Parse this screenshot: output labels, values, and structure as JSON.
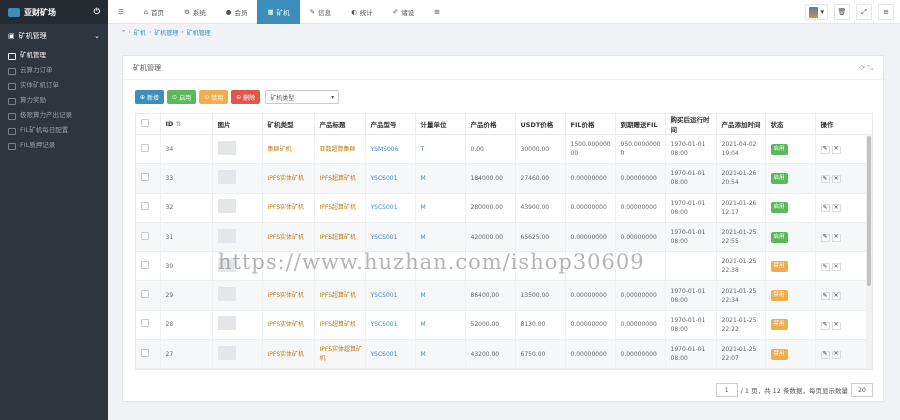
{
  "app": {
    "logo_text": "亚财矿场"
  },
  "sidebar": {
    "section": "矿机管理",
    "items": [
      {
        "label": "矿机管理"
      },
      {
        "label": "云算力订单"
      },
      {
        "label": "实体矿机订单"
      },
      {
        "label": "算力奖励"
      },
      {
        "label": "极限算力产出记录"
      },
      {
        "label": "FIL矿机每日配置"
      },
      {
        "label": "FIL质押记录"
      }
    ]
  },
  "topnav": {
    "items": [
      {
        "label": "首页",
        "icon": "home"
      },
      {
        "label": "系统",
        "icon": "gear"
      },
      {
        "label": "会员",
        "icon": "user"
      },
      {
        "label": "矿机",
        "icon": "grid"
      },
      {
        "label": "信息",
        "icon": "wrench"
      },
      {
        "label": "统计",
        "icon": "chart"
      },
      {
        "label": "诸设",
        "icon": "edit"
      }
    ]
  },
  "breadcrumb": {
    "items": [
      "矿机",
      "矿机管理",
      "矿机管理"
    ]
  },
  "panel": {
    "title": "矿机管理"
  },
  "toolbar": {
    "add": "新增",
    "enable": "启用",
    "disable": "禁用",
    "delete": "删除",
    "filter_label": "矿机类型"
  },
  "table": {
    "headers": [
      "ID",
      "图片",
      "矿机类型",
      "产品标题",
      "产品型号",
      "计量单位",
      "产品价格",
      "USDT价格",
      "FIL价格",
      "到期赠送FIL",
      "购买后运行时间",
      "产品添加时间",
      "状态",
      "操作"
    ],
    "rows": [
      {
        "id": "34",
        "type": "集群矿机",
        "title": "亚数超算集群",
        "model": "YSMS006",
        "unit": "T",
        "price": "0.00",
        "usdt": "30000.00",
        "fil": "1500.000000 00",
        "gift": "950.0000000 0",
        "run": "1970-01-01 08:00",
        "added": "2021-04-02 19:04",
        "status": "启用"
      },
      {
        "id": "33",
        "type": "IPFS实体矿机",
        "title": "IPFS超算矿机",
        "model": "YSCS001",
        "unit": "M",
        "price": "184000.00",
        "usdt": "27460.00",
        "fil": "0.00000000",
        "gift": "0.00000000",
        "run": "1970-01-01 08:00",
        "added": "2021-01-26 20:54",
        "status": "启用"
      },
      {
        "id": "32",
        "type": "IPFS实体矿机",
        "title": "IPFS超算矿机",
        "model": "YSCS001",
        "unit": "M",
        "price": "280000.00",
        "usdt": "43900.00",
        "fil": "0.00000000",
        "gift": "0.00000000",
        "run": "1970-01-01 08:00",
        "added": "2021-01-26 12:17",
        "status": "启用"
      },
      {
        "id": "31",
        "type": "IPFS实体矿机",
        "title": "IPFS超算矿机",
        "model": "YSCS001",
        "unit": "M",
        "price": "420000.00",
        "usdt": "65625.00",
        "fil": "0.00000000",
        "gift": "0.00000000",
        "run": "1970-01-01 08:00",
        "added": "2021-01-25 22:55",
        "status": "启用"
      },
      {
        "id": "30",
        "type": "",
        "title": "",
        "model": "",
        "unit": "",
        "price": "",
        "usdt": "",
        "fil": "",
        "gift": "",
        "run": "",
        "added": "2021-01-25 22:38",
        "status": "禁用"
      },
      {
        "id": "29",
        "type": "IPFS实体矿机",
        "title": "IPFS超算矿机",
        "model": "YSCS001",
        "unit": "M",
        "price": "86400.00",
        "usdt": "13500.00",
        "fil": "0.00000000",
        "gift": "0.00000000",
        "run": "1970-01-01 08:00",
        "added": "2021-01-25 22:34",
        "status": "禁用"
      },
      {
        "id": "28",
        "type": "IPFS实体矿机",
        "title": "IPFS超算矿机",
        "model": "YSCS001",
        "unit": "M",
        "price": "52000.00",
        "usdt": "8130.00",
        "fil": "0.00000000",
        "gift": "0.00000000",
        "run": "1970-01-01 08:00",
        "added": "2021-01-25 22:22",
        "status": "禁用"
      },
      {
        "id": "27",
        "type": "IPFS实体矿机",
        "title": "IPFS实体超算矿机",
        "model": "YSCS001",
        "unit": "M",
        "price": "43200.00",
        "usdt": "6750.00",
        "fil": "0.00000000",
        "gift": "0.00000000",
        "run": "1970-01-01 08:00",
        "added": "2021-01-25 22:07",
        "status": "禁用"
      }
    ]
  },
  "pager": {
    "page": "1",
    "text": "/ 1 页，共 12 条数据，每页显示数量",
    "per_page": "20"
  },
  "watermark": "https://www.huzhan.com/ishop30609"
}
